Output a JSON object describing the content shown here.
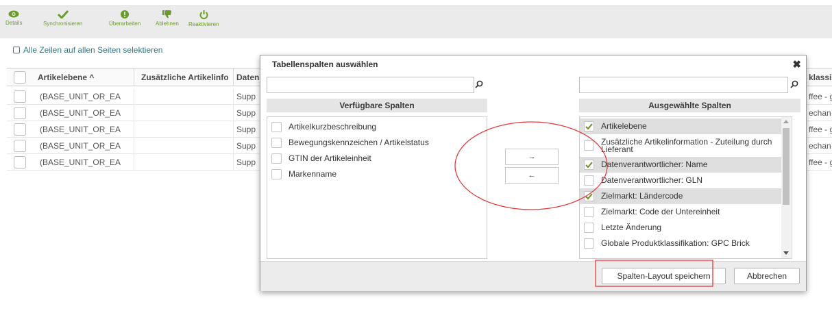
{
  "toolbar": {
    "details": "Details",
    "synchronisieren": "Synchronisieren",
    "ueberarbeiten": "Überarbeiten",
    "ablehnen": "Ablehnen",
    "reaktivieren": "Reaktivieren"
  },
  "select_all": "Alle Zeilen auf allen Seiten selektieren",
  "grid": {
    "headers": [
      "Artikelebene ^",
      "Zusätzliche Artikelinfo",
      "Daten",
      "klassi"
    ],
    "rows": [
      {
        "ebene": "(BASE_UNIT_OR_EA",
        "daten": "Supp",
        "klass": "ffee - g"
      },
      {
        "ebene": "(BASE_UNIT_OR_EA",
        "daten": "Supp",
        "klass": "echan"
      },
      {
        "ebene": "(BASE_UNIT_OR_EA",
        "daten": "Supp",
        "klass": "ffee - g"
      },
      {
        "ebene": "(BASE_UNIT_OR_EA",
        "daten": "Supp",
        "klass": "echan"
      },
      {
        "ebene": "(BASE_UNIT_OR_EA",
        "daten": "Supp",
        "klass": "ffee - g"
      }
    ]
  },
  "dialog": {
    "title": "Tabellenspalten auswählen",
    "left_search_value": "",
    "right_search_value": "",
    "available_header": "Verfügbare Spalten",
    "selected_header": "Ausgewählte Spalten",
    "available_items": [
      "Artikelkurzbeschreibung",
      "Bewegungskennzeichen / Artikelstatus",
      "GTIN der Artikeleinheit",
      "Markenname"
    ],
    "selected_items": [
      {
        "label": "Artikelebene",
        "checked": true,
        "highlighted": true
      },
      {
        "label": "Zusätzliche Artikelinformation - Zuteilung durch Lieferant",
        "checked": false,
        "highlighted": false
      },
      {
        "label": "Datenverantwortlicher: Name",
        "checked": true,
        "highlighted": true
      },
      {
        "label": "Datenverantwortlicher: GLN",
        "checked": false,
        "highlighted": false
      },
      {
        "label": "Zielmarkt: Ländercode",
        "checked": true,
        "highlighted": true
      },
      {
        "label": "Zielmarkt: Code der Untereinheit",
        "checked": false,
        "highlighted": false
      },
      {
        "label": "Letzte Änderung",
        "checked": false,
        "highlighted": false
      },
      {
        "label": "Globale Produktklassifikation: GPC Brick",
        "checked": false,
        "highlighted": false
      }
    ],
    "move_right": "→",
    "move_left": "←",
    "save_button": "Spalten-Layout speichern",
    "cancel_button": "Abbrechen",
    "close_icon": "close-icon"
  },
  "colors": {
    "toolbar_icon": "#6a9c2b",
    "select_all_text": "#2f7a8a",
    "annotation_red": "#e23a3a",
    "check_mark": "#6b8e23"
  }
}
